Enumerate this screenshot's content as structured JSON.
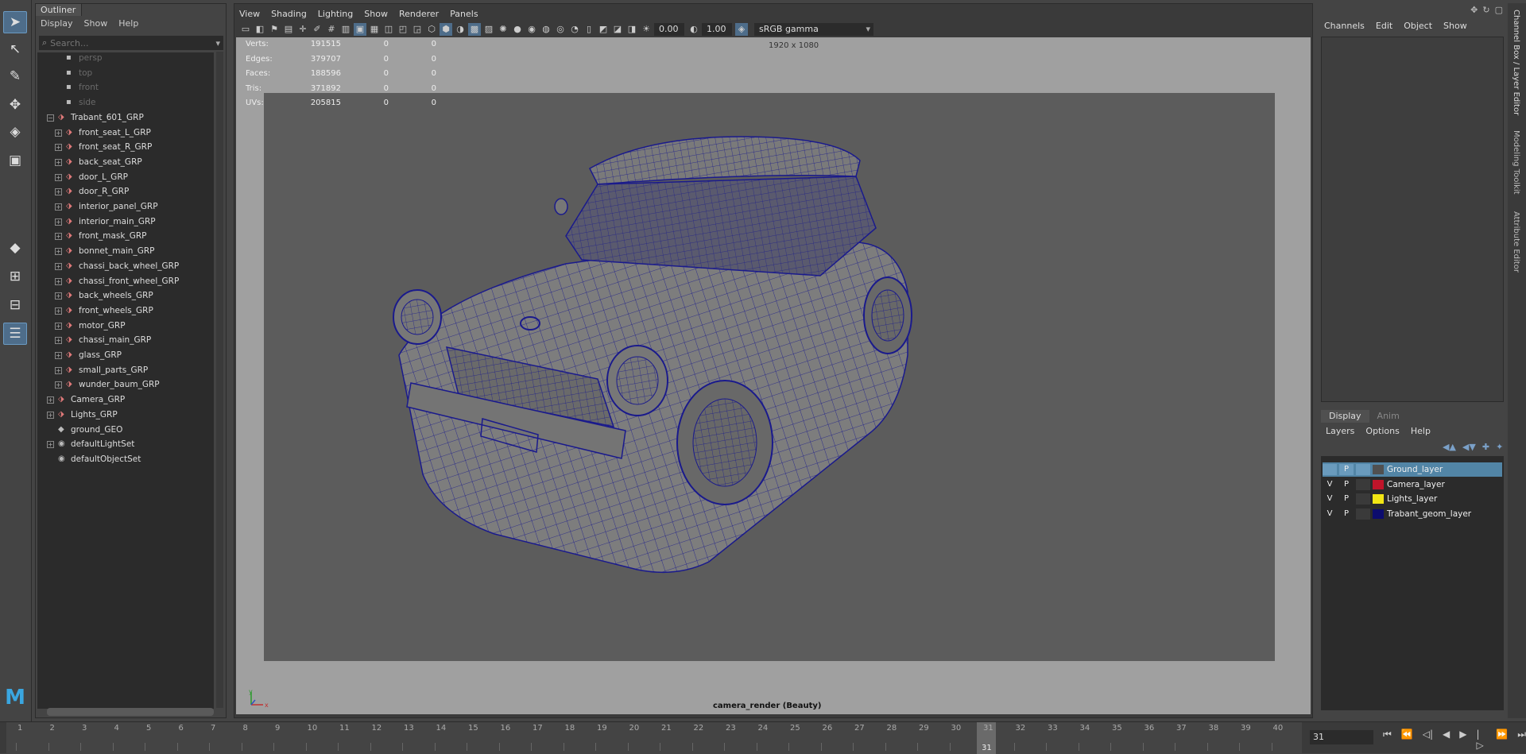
{
  "outliner": {
    "tab": "Outliner",
    "menu": [
      "Display",
      "Show",
      "Help"
    ],
    "search_placeholder": "Search...",
    "items": [
      {
        "label": "persp",
        "indent": 1,
        "icon": "camera",
        "dim": true
      },
      {
        "label": "top",
        "indent": 1,
        "icon": "camera",
        "dim": true
      },
      {
        "label": "front",
        "indent": 1,
        "icon": "camera",
        "dim": true
      },
      {
        "label": "side",
        "indent": 1,
        "icon": "camera",
        "dim": true
      },
      {
        "label": "Trabant_601_GRP",
        "indent": 0,
        "icon": "group",
        "exp": "−"
      },
      {
        "label": "front_seat_L_GRP",
        "indent": 1,
        "icon": "group",
        "exp": "+"
      },
      {
        "label": "front_seat_R_GRP",
        "indent": 1,
        "icon": "group",
        "exp": "+"
      },
      {
        "label": "back_seat_GRP",
        "indent": 1,
        "icon": "group",
        "exp": "+"
      },
      {
        "label": "door_L_GRP",
        "indent": 1,
        "icon": "group",
        "exp": "+"
      },
      {
        "label": "door_R_GRP",
        "indent": 1,
        "icon": "group",
        "exp": "+"
      },
      {
        "label": "interior_panel_GRP",
        "indent": 1,
        "icon": "group",
        "exp": "+"
      },
      {
        "label": "interior_main_GRP",
        "indent": 1,
        "icon": "group",
        "exp": "+"
      },
      {
        "label": "front_mask_GRP",
        "indent": 1,
        "icon": "group",
        "exp": "+"
      },
      {
        "label": "bonnet_main_GRP",
        "indent": 1,
        "icon": "group",
        "exp": "+"
      },
      {
        "label": "chassi_back_wheel_GRP",
        "indent": 1,
        "icon": "group",
        "exp": "+"
      },
      {
        "label": "chassi_front_wheel_GRP",
        "indent": 1,
        "icon": "group",
        "exp": "+"
      },
      {
        "label": "back_wheels_GRP",
        "indent": 1,
        "icon": "group",
        "exp": "+"
      },
      {
        "label": "front_wheels_GRP",
        "indent": 1,
        "icon": "group",
        "exp": "+"
      },
      {
        "label": "motor_GRP",
        "indent": 1,
        "icon": "group",
        "exp": "+"
      },
      {
        "label": "chassi_main_GRP",
        "indent": 1,
        "icon": "group",
        "exp": "+"
      },
      {
        "label": "glass_GRP",
        "indent": 1,
        "icon": "group",
        "exp": "+"
      },
      {
        "label": "small_parts_GRP",
        "indent": 1,
        "icon": "group",
        "exp": "+"
      },
      {
        "label": "wunder_baum_GRP",
        "indent": 1,
        "icon": "group",
        "exp": "+"
      },
      {
        "label": "Camera_GRP",
        "indent": 0,
        "icon": "group",
        "exp": "+"
      },
      {
        "label": "Lights_GRP",
        "indent": 0,
        "icon": "group",
        "exp": "+"
      },
      {
        "label": "ground_GEO",
        "indent": 0,
        "icon": "mesh"
      },
      {
        "label": "defaultLightSet",
        "indent": 0,
        "icon": "set",
        "exp": "+"
      },
      {
        "label": "defaultObjectSet",
        "indent": 0,
        "icon": "set"
      }
    ]
  },
  "viewport": {
    "menu": [
      "View",
      "Shading",
      "Lighting",
      "Show",
      "Renderer",
      "Panels"
    ],
    "exposure": "0.00",
    "gamma": "1.00",
    "color_space": "sRGB gamma",
    "resolution": "1920 x 1080",
    "camera_label": "camera_render (Beauty)",
    "hud": [
      {
        "label": "Verts:",
        "v1": "191515",
        "v2": "0",
        "v3": "0"
      },
      {
        "label": "Edges:",
        "v1": "379707",
        "v2": "0",
        "v3": "0"
      },
      {
        "label": "Faces:",
        "v1": "188596",
        "v2": "0",
        "v3": "0"
      },
      {
        "label": "Tris:",
        "v1": "371892",
        "v2": "0",
        "v3": "0"
      },
      {
        "label": "UVs:",
        "v1": "205815",
        "v2": "0",
        "v3": "0"
      }
    ],
    "wire_color": "#1a1a8c"
  },
  "channel_box": {
    "menu": [
      "Channels",
      "Edit",
      "Object",
      "Show"
    ]
  },
  "layer_editor": {
    "tabs": [
      "Display",
      "Anim"
    ],
    "menu": [
      "Layers",
      "Options",
      "Help"
    ],
    "layers": [
      {
        "name": "Ground_layer",
        "v": "",
        "p": "P",
        "color": "#505050",
        "selected": true
      },
      {
        "name": "Camera_layer",
        "v": "V",
        "p": "P",
        "color": "#c0142a",
        "selected": false
      },
      {
        "name": "Lights_layer",
        "v": "V",
        "p": "P",
        "color": "#f2e614",
        "selected": false
      },
      {
        "name": "Trabant_geom_layer",
        "v": "V",
        "p": "P",
        "color": "#0c0c6e",
        "selected": false
      }
    ]
  },
  "side_tabs": [
    "Channel Box / Layer Editor",
    "Modeling Toolkit",
    "Attribute Editor"
  ],
  "timeline": {
    "ticks": [
      "1",
      "2",
      "3",
      "4",
      "5",
      "6",
      "7",
      "8",
      "9",
      "10",
      "11",
      "12",
      "13",
      "14",
      "15",
      "16",
      "17",
      "18",
      "19",
      "20",
      "21",
      "22",
      "23",
      "24",
      "25",
      "26",
      "27",
      "28",
      "29",
      "30",
      "31",
      "32",
      "33",
      "34",
      "35",
      "36",
      "37",
      "38",
      "39",
      "40"
    ],
    "current": "31",
    "current_field": "31"
  }
}
